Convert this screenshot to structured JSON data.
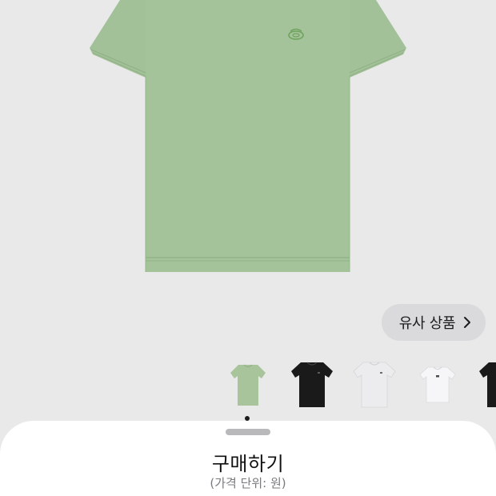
{
  "product": {
    "color": "#a5c39a",
    "logo_color": "#6fa35e"
  },
  "similar_products": {
    "label": "유사 상품",
    "icon": "chevron-right-icon"
  },
  "thumbnails": [
    {
      "name": "green-tshirt",
      "color": "#a8c49a"
    },
    {
      "name": "black-tshirt",
      "color": "#1a1a1a"
    },
    {
      "name": "white-tshirt",
      "color": "#ececee"
    },
    {
      "name": "white-tshirt-2",
      "color": "#f6f6f8"
    },
    {
      "name": "black-tshirt-2",
      "color": "#1a1a1a"
    }
  ],
  "sheet": {
    "title": "구매하기",
    "subtitle": "(가격 단위: 원)"
  }
}
